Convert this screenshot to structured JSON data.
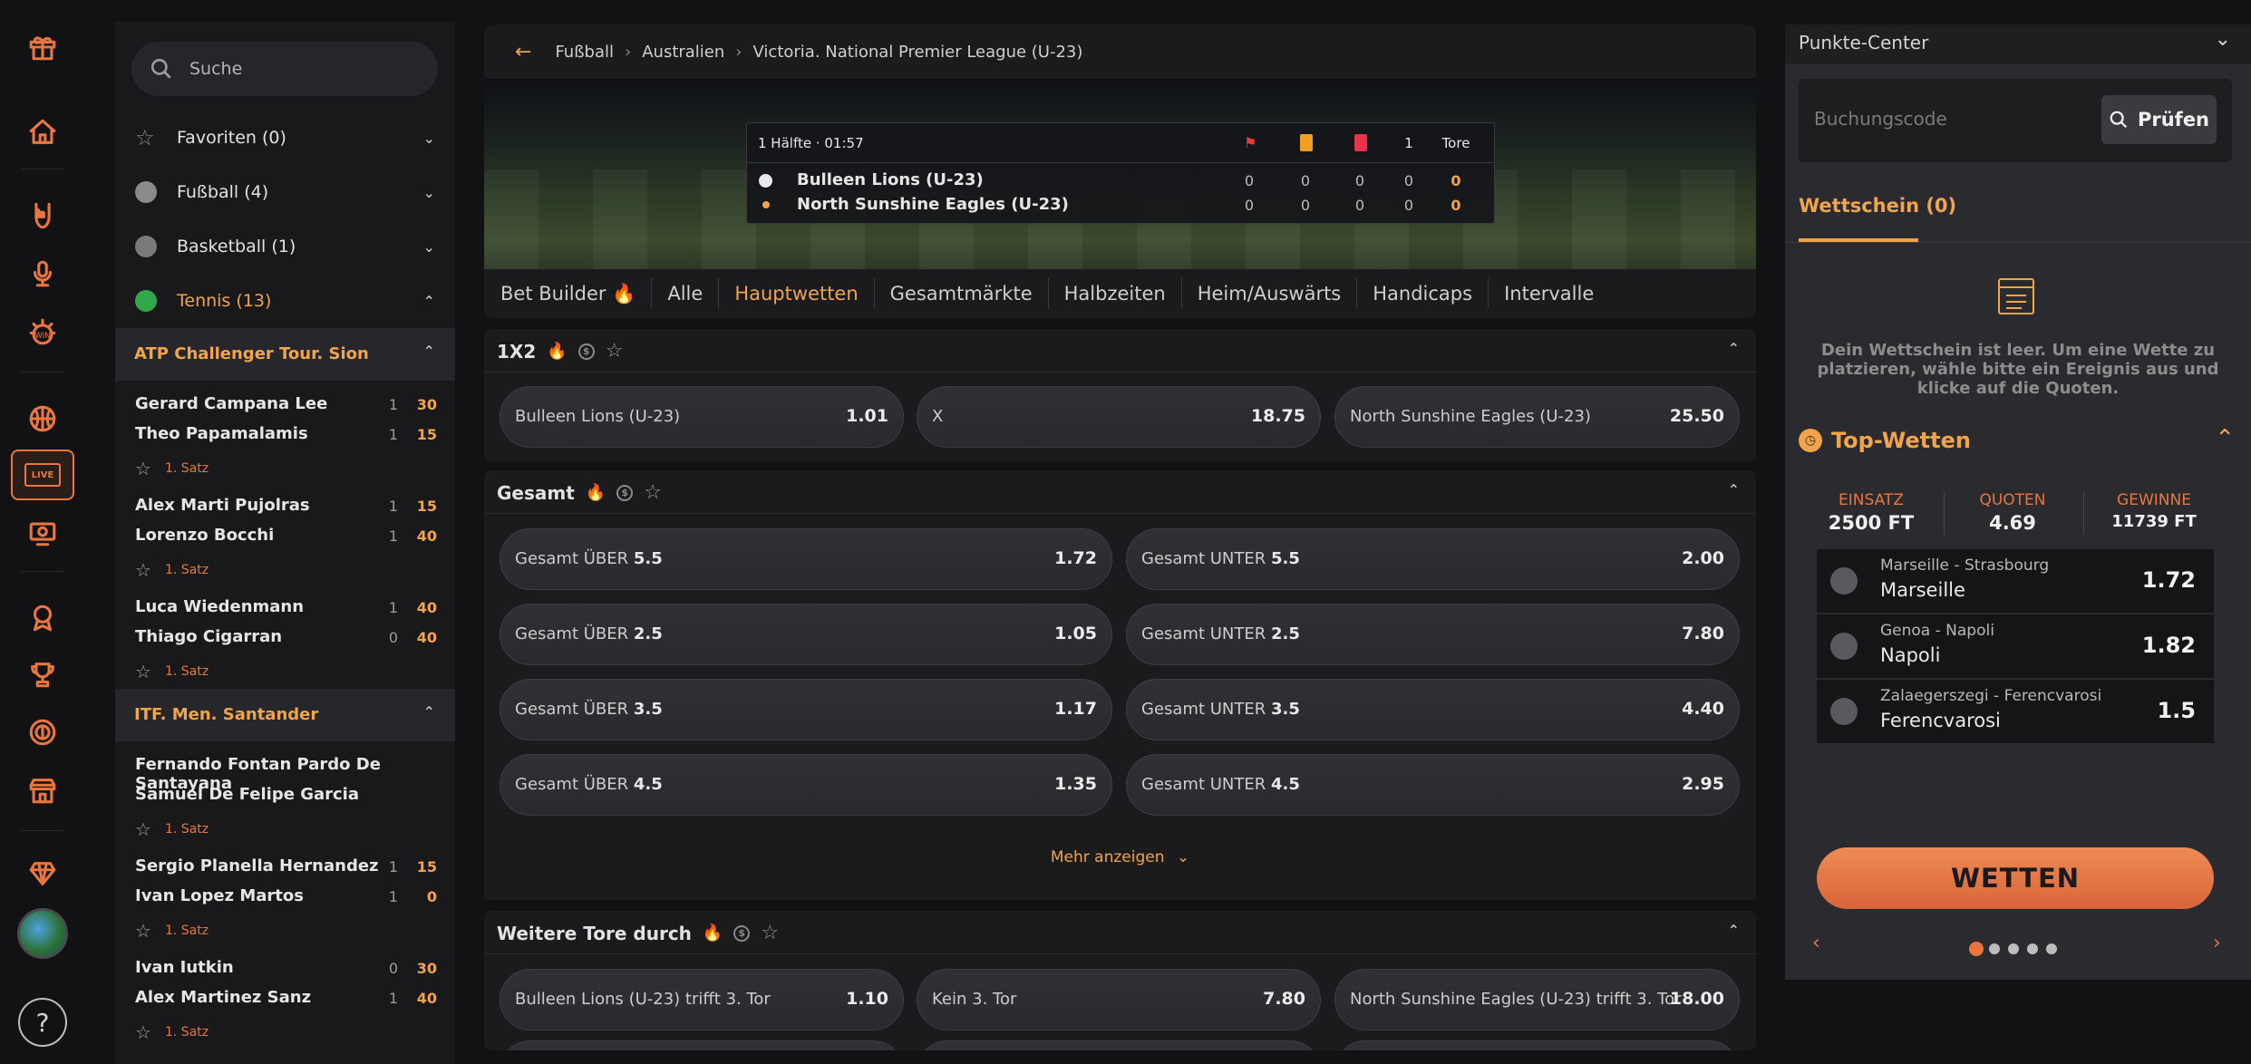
{
  "sidebar": {
    "search_placeholder": "Suche",
    "sports": [
      {
        "label": "Favoriten (0)",
        "icon": "star-icon"
      },
      {
        "label": "Fußball (4)",
        "icon": "soccer-ball-icon"
      },
      {
        "label": "Basketball (1)",
        "icon": "basketball-icon"
      },
      {
        "label": "Tennis (13)",
        "icon": "tennis-ball-icon"
      }
    ],
    "categories": [
      {
        "name": "ATP Challenger Tour. Sion",
        "matches": [
          {
            "p1": "Gerard Campana Lee",
            "p2": "Theo Papamalamis",
            "s1a": "1",
            "s1b": "1",
            "s2a": "30",
            "s2b": "15",
            "set": "1. Satz"
          },
          {
            "p1": "Alex Marti Pujolras",
            "p2": "Lorenzo Bocchi",
            "s1a": "1",
            "s1b": "1",
            "s2a": "15",
            "s2b": "40",
            "set": "1. Satz"
          },
          {
            "p1": "Luca Wiedenmann",
            "p2": "Thiago Cigarran",
            "s1a": "1",
            "s1b": "0",
            "s2a": "40",
            "s2b": "40",
            "set": "1. Satz"
          }
        ]
      },
      {
        "name": "ITF. Men. Santander",
        "matches": [
          {
            "p1": "Fernando Fontan Pardo De Santayana",
            "p2": "Samuel De Felipe Garcia",
            "s1a": "",
            "s1b": "",
            "s2a": "",
            "s2b": "",
            "set": "1. Satz"
          },
          {
            "p1": "Sergio Planella Hernandez",
            "p2": "Ivan Lopez Martos",
            "s1a": "1",
            "s1b": "1",
            "s2a": "15",
            "s2b": "0",
            "set": "1. Satz"
          },
          {
            "p1": "Ivan Iutkin",
            "p2": "Alex Martinez Sanz",
            "s1a": "0",
            "s1b": "1",
            "s2a": "30",
            "s2b": "40",
            "set": "1. Satz"
          }
        ]
      }
    ]
  },
  "breadcrumb": [
    "Fußball",
    "Australien",
    "Victoria. National Premier League (U-23)"
  ],
  "scoreboard": {
    "time": "1 Hälfte · 01:57",
    "col_goals_num": "1",
    "col_goals": "Tore",
    "teams": [
      {
        "name": "Bulleen Lions (U-23)",
        "vals": [
          "0",
          "0",
          "0",
          "0",
          "0"
        ]
      },
      {
        "name": "North Sunshine Eagles (U-23)",
        "vals": [
          "0",
          "0",
          "0",
          "0",
          "0"
        ]
      }
    ]
  },
  "tabs": [
    "Bet Builder",
    "Alle",
    "Hauptwetten",
    "Gesamtmärkte",
    "Halbzeiten",
    "Heim/Auswärts",
    "Handicaps",
    "Intervalle"
  ],
  "active_tab": "Hauptwetten",
  "markets": {
    "x12": {
      "title": "1X2",
      "odds": [
        {
          "label": "Bulleen Lions (U-23)",
          "value": "1.01"
        },
        {
          "label": "X",
          "value": "18.75"
        },
        {
          "label": "North Sunshine Eagles (U-23)",
          "value": "25.50"
        }
      ]
    },
    "gesamt": {
      "title": "Gesamt",
      "rows": [
        [
          {
            "label": "Gesamt ÜBER",
            "line": "5.5",
            "value": "1.72"
          },
          {
            "label": "Gesamt UNTER",
            "line": "5.5",
            "value": "2.00"
          }
        ],
        [
          {
            "label": "Gesamt ÜBER",
            "line": "2.5",
            "value": "1.05"
          },
          {
            "label": "Gesamt UNTER",
            "line": "2.5",
            "value": "7.80"
          }
        ],
        [
          {
            "label": "Gesamt ÜBER",
            "line": "3.5",
            "value": "1.17"
          },
          {
            "label": "Gesamt UNTER",
            "line": "3.5",
            "value": "4.40"
          }
        ],
        [
          {
            "label": "Gesamt ÜBER",
            "line": "4.5",
            "value": "1.35"
          },
          {
            "label": "Gesamt UNTER",
            "line": "4.5",
            "value": "2.95"
          }
        ]
      ],
      "more": "Mehr anzeigen"
    },
    "tore": {
      "title": "Weitere Tore durch",
      "odds": [
        {
          "label": "Bulleen Lions (U-23) trifft 3. Tor",
          "value": "1.10"
        },
        {
          "label": "Kein 3. Tor",
          "value": "7.80"
        },
        {
          "label": "North Sunshine Eagles (U-23) trifft 3. Tor",
          "value": "18.00"
        }
      ]
    }
  },
  "right": {
    "punkte_title": "Punkte-Center",
    "code_placeholder": "Buchungscode",
    "pruefen": "Prüfen",
    "wettschein_tab": "Wettschein (0)",
    "empty_text": "Dein Wettschein ist leer. Um eine Wette zu platzieren, wähle bitte ein Ereignis aus und klicke auf die Quoten.",
    "top_title": "Top-Wetten",
    "stats": [
      {
        "k": "EINSATZ",
        "v": "2500 FT"
      },
      {
        "k": "QUOTEN",
        "v": "4.69"
      },
      {
        "k": "GEWINNE",
        "v": "11739 FT"
      }
    ],
    "top_bets": [
      {
        "match": "Marseille - Strasbourg",
        "pick": "Marseille",
        "odd": "1.72"
      },
      {
        "match": "Genoa - Napoli",
        "pick": "Napoli",
        "odd": "1.82"
      },
      {
        "match": "Zalaegerszegi - Ferencvarosi",
        "pick": "Ferencvarosi",
        "odd": "1.5"
      }
    ],
    "wetten_button": "WETTEN",
    "prev_label": "‹",
    "next_label": "›"
  },
  "colors": {
    "accent": "#f0a54a",
    "accent2": "#e8763e",
    "bg": "#121214",
    "panel": "#1b1b1e"
  }
}
